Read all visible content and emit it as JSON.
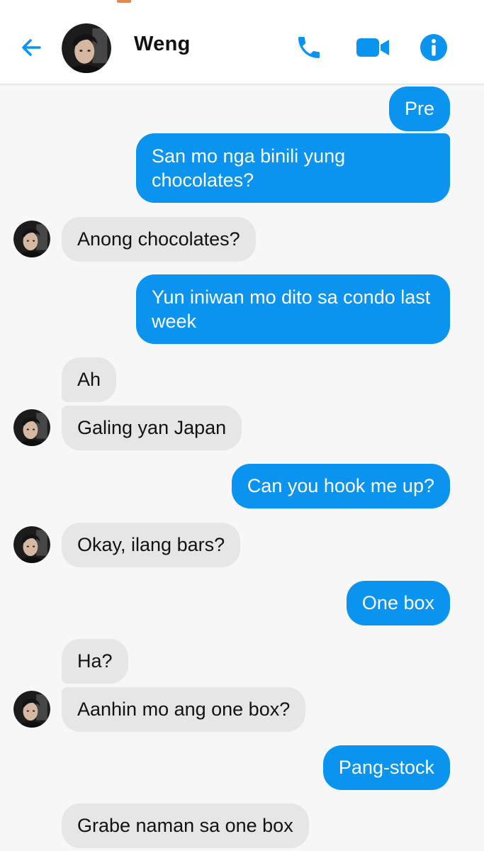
{
  "header": {
    "contact_name": "Weng"
  },
  "colors": {
    "accent": "#0a93ef",
    "incoming_bubble": "#e6e6e7",
    "background": "#f7f7f8"
  },
  "icons": {
    "back": "arrow-left-icon",
    "call": "phone-icon",
    "video": "video-camera-icon",
    "info": "info-icon"
  },
  "messages": [
    {
      "sender": "me",
      "text": "Pre"
    },
    {
      "sender": "me",
      "text": "San mo nga binili yung chocolates?"
    },
    {
      "sender": "Weng",
      "text": "Anong chocolates?"
    },
    {
      "sender": "me",
      "text": "Yun iniwan mo dito sa condo last week"
    },
    {
      "sender": "Weng",
      "text": "Ah"
    },
    {
      "sender": "Weng",
      "text": "Galing yan Japan"
    },
    {
      "sender": "me",
      "text": "Can you hook me up?"
    },
    {
      "sender": "Weng",
      "text": "Okay, ilang bars?"
    },
    {
      "sender": "me",
      "text": "One box"
    },
    {
      "sender": "Weng",
      "text": "Ha?"
    },
    {
      "sender": "Weng",
      "text": "Aanhin mo ang one box?"
    },
    {
      "sender": "me",
      "text": "Pang-stock"
    },
    {
      "sender": "Weng",
      "text": "Grabe naman sa one box"
    }
  ]
}
